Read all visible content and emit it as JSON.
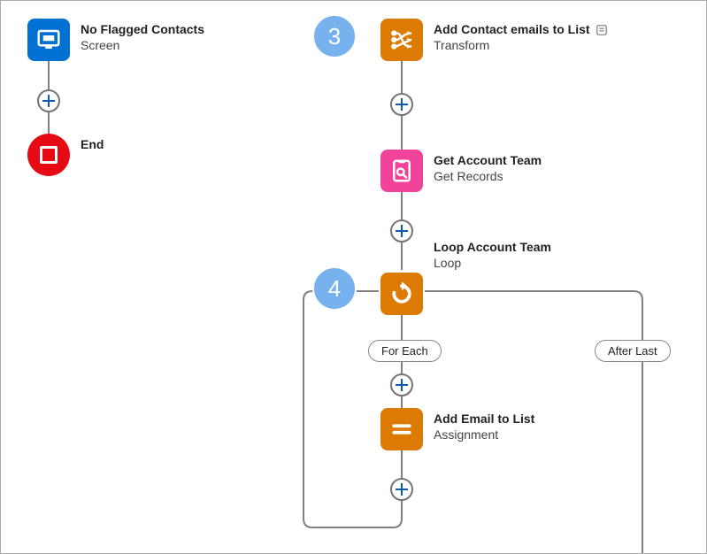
{
  "left": {
    "screen": {
      "title": "No Flagged Contacts",
      "sub": "Screen"
    },
    "end": {
      "title": "End"
    }
  },
  "right": {
    "badge3": "3",
    "badge4": "4",
    "transform": {
      "title": "Add Contact emails to List",
      "sub": "Transform"
    },
    "getRecords": {
      "title": "Get Account Team",
      "sub": "Get Records"
    },
    "loop": {
      "title": "Loop Account Team",
      "sub": "Loop"
    },
    "assignment": {
      "title": "Add Email to List",
      "sub": "Assignment"
    },
    "forEach": "For Each",
    "afterLast": "After Last"
  }
}
